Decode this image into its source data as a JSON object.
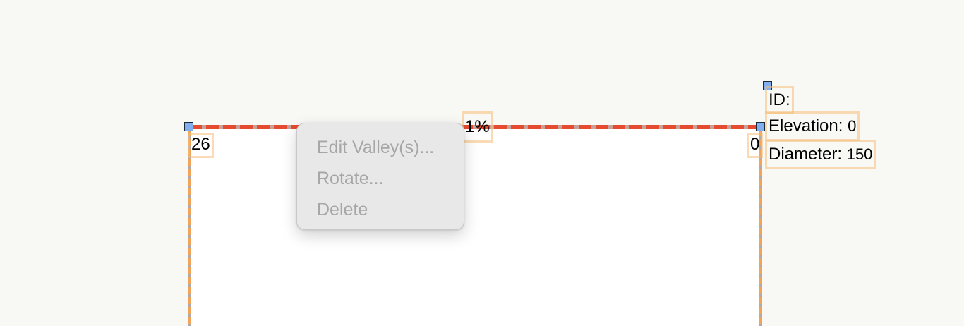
{
  "labels": {
    "top_left_value": "26",
    "top_mid_value": "1%",
    "top_right_value": "0",
    "id_label": "ID:",
    "elevation_label": "Elevation:",
    "elevation_value": "0",
    "diameter_label": "Diameter:",
    "diameter_value": "150"
  },
  "context_menu": {
    "items": [
      {
        "label": "Edit Valley(s)...",
        "enabled": false
      },
      {
        "label": "Rotate...",
        "enabled": false
      },
      {
        "label": "Delete",
        "enabled": false
      }
    ]
  },
  "colors": {
    "background": "#f8f8f4",
    "shape_fill": "#ffffff",
    "edge_red": "#e54b2e",
    "edge_orange": "#f0a55a",
    "handle": "#82aff0",
    "menu_bg": "#e8e8e8",
    "menu_disabled_text": "#a6a6a6"
  }
}
